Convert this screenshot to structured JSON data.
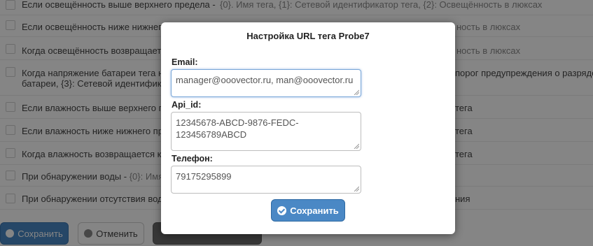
{
  "background": {
    "rows": [
      {
        "left": "Если освещённость выше верхнего предела -",
        "right": "{0}. Имя тега, {1}: Сетевой идентификатор тега, {2}: Освещённость в люксах"
      },
      {
        "left": "Если освещённость ниже нижнего",
        "right": "ность в люксах"
      },
      {
        "left": "Когда освещённость возвращается",
        "right": "ность в люксах"
      },
      {
        "left": "Когда напряжение батареи тега на",
        "right": "порог предупреждения о разряде",
        "left2": "батареи, {3}: Сетевой идентифика"
      },
      {
        "left": "Если влажность выше верхнего пре",
        "right": "тега"
      },
      {
        "left": "Если влажность ниже нижнего пре",
        "right": "тега"
      },
      {
        "left": "Когда влажность возвращается к",
        "right": "тега"
      },
      {
        "left": "При обнаружении воды -",
        "left_muted": "{0}: Имя",
        "right": ""
      },
      {
        "left": "При обнаружении отсутствия вод",
        "right": "ния"
      }
    ],
    "buttons": {
      "save": "Сохранить",
      "cancel": "Отменить"
    }
  },
  "modal": {
    "title": "Настройка URL тега Probe7",
    "email_label": "Email:",
    "email_value": "manager@ooovector.ru, man@ooovector.ru",
    "api_label": "Api_id:",
    "api_value": "12345678-ABCD-9876-FEDC-123456789ABCD",
    "phone_label": "Телефон:",
    "phone_value": "79175295899",
    "save_label": "Сохранить"
  },
  "colors": {
    "accent": "#4a88c5",
    "overlay": "rgba(0,0,0,0.48)"
  }
}
